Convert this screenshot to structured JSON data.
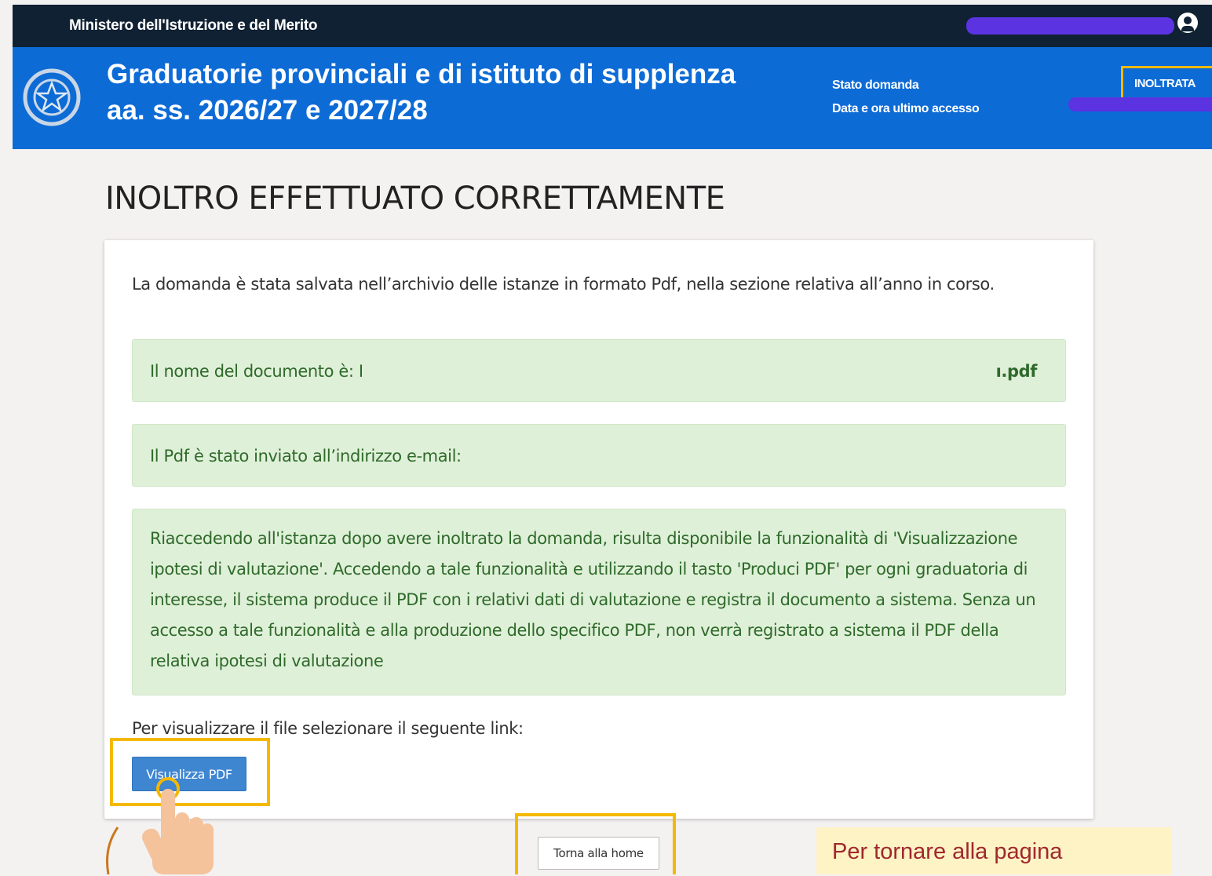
{
  "topbar": {
    "ministry": "Ministero dell'Istruzione e del Merito"
  },
  "header": {
    "title_line1": "Graduatorie provinciali e di istituto di supplenza",
    "title_line2": "aa. ss. 2026/27 e 2027/28",
    "stato_label": "Stato domanda",
    "data_label": "Data e ora ultimo accesso",
    "status_value": "INOLTRATA"
  },
  "page": {
    "title": "INOLTRO EFFETTUATO CORRETTAMENTE"
  },
  "card": {
    "intro": "La domanda è stata salvata nell’archivio delle istanze in formato Pdf, nella sezione relativa all’anno in corso.",
    "doc_name_label": "Il nome del documento è: I",
    "doc_ext": "ı.pdf",
    "email_label": "Il Pdf è stato inviato all’indirizzo e-mail:",
    "info_text": "Riaccedendo all'istanza dopo avere inoltrato la domanda, risulta disponibile la funzionalità di 'Visualizzazione ipotesi di valutazione'. Accedendo a tale funzionalità e utilizzando il tasto 'Produci PDF' per ogni graduatoria di interesse, il sistema produce il PDF con i relativi dati di valutazione e registra il documento a sistema. Senza un accesso a tale funzionalità e alla produzione dello specifico PDF, non verrà registrato a sistema il PDF della relativa ipotesi di valutazione",
    "link_prompt": "Per visualizzare il file selezionare il seguente link:",
    "pdf_button": "Visualizza PDF"
  },
  "home_button": "Torna alla home",
  "note": "Per tornare alla pagina",
  "colors": {
    "topbar": "#0f2133",
    "header": "#0d6bd6",
    "highlight": "#f5b800",
    "alert_bg": "#dff0d8",
    "alert_text": "#2f6a2b",
    "button": "#3f86d1",
    "note_bg": "#fdf3c5",
    "note_text": "#a0282e"
  },
  "icons": [
    "user-icon",
    "emblem-icon",
    "pointer-hand-icon"
  ]
}
